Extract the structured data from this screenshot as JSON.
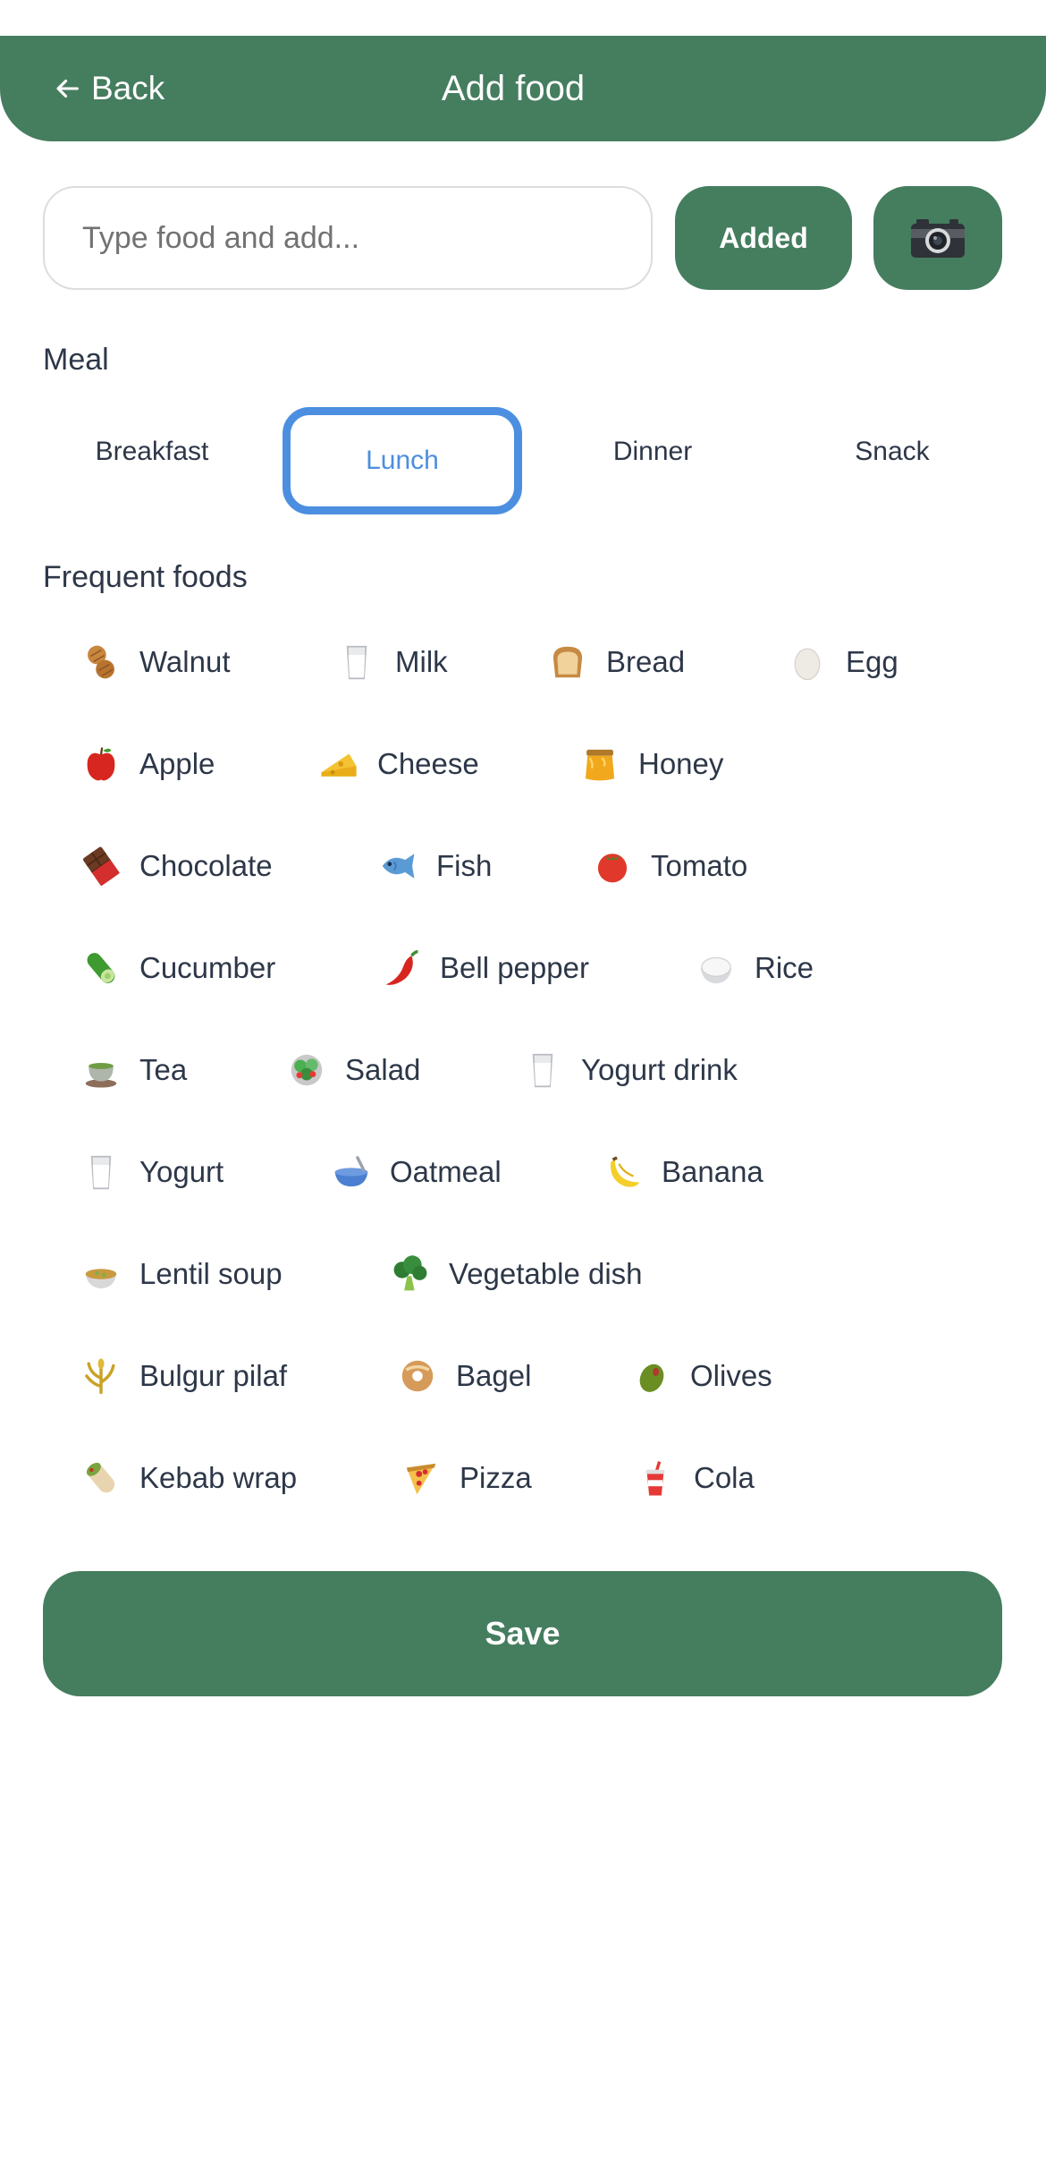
{
  "header": {
    "back_label": "Back",
    "title": "Add food"
  },
  "search": {
    "placeholder": "Type food and add..."
  },
  "actions": {
    "added_label": "Added",
    "camera_icon": "camera-icon"
  },
  "meal": {
    "label": "Meal",
    "options": [
      "Breakfast",
      "Lunch",
      "Dinner",
      "Snack"
    ],
    "selected": "Lunch"
  },
  "frequent": {
    "label": "Frequent foods",
    "items": [
      {
        "label": "Walnut",
        "icon": "peanuts-icon"
      },
      {
        "label": "Milk",
        "icon": "milk-glass-icon"
      },
      {
        "label": "Bread",
        "icon": "bread-icon"
      },
      {
        "label": "Egg",
        "icon": "egg-icon"
      },
      {
        "label": "Apple",
        "icon": "apple-icon"
      },
      {
        "label": "Cheese",
        "icon": "cheese-icon"
      },
      {
        "label": "Honey",
        "icon": "honey-pot-icon"
      },
      {
        "label": "Chocolate",
        "icon": "chocolate-icon"
      },
      {
        "label": "Fish",
        "icon": "fish-icon"
      },
      {
        "label": "Tomato",
        "icon": "tomato-icon"
      },
      {
        "label": "Cucumber",
        "icon": "cucumber-icon"
      },
      {
        "label": "Bell pepper",
        "icon": "hot-pepper-icon"
      },
      {
        "label": "Rice",
        "icon": "rice-icon"
      },
      {
        "label": "Tea",
        "icon": "tea-icon"
      },
      {
        "label": "Salad",
        "icon": "salad-icon"
      },
      {
        "label": "Yogurt drink",
        "icon": "drink-glass-icon"
      },
      {
        "label": "Yogurt",
        "icon": "yogurt-glass-icon"
      },
      {
        "label": "Oatmeal",
        "icon": "bowl-icon"
      },
      {
        "label": "Banana",
        "icon": "banana-icon"
      },
      {
        "label": "Lentil soup",
        "icon": "soup-icon"
      },
      {
        "label": "Vegetable dish",
        "icon": "broccoli-icon"
      },
      {
        "label": "Bulgur pilaf",
        "icon": "grain-icon"
      },
      {
        "label": "Bagel",
        "icon": "bagel-icon"
      },
      {
        "label": "Olives",
        "icon": "olive-icon"
      },
      {
        "label": "Kebab wrap",
        "icon": "burrito-icon"
      },
      {
        "label": "Pizza",
        "icon": "pizza-icon"
      },
      {
        "label": "Cola",
        "icon": "cup-with-straw-icon"
      }
    ]
  },
  "save_label": "Save",
  "colors": {
    "primary": "#457d5f",
    "selected": "#4c8fe0",
    "text": "#2d3748"
  }
}
